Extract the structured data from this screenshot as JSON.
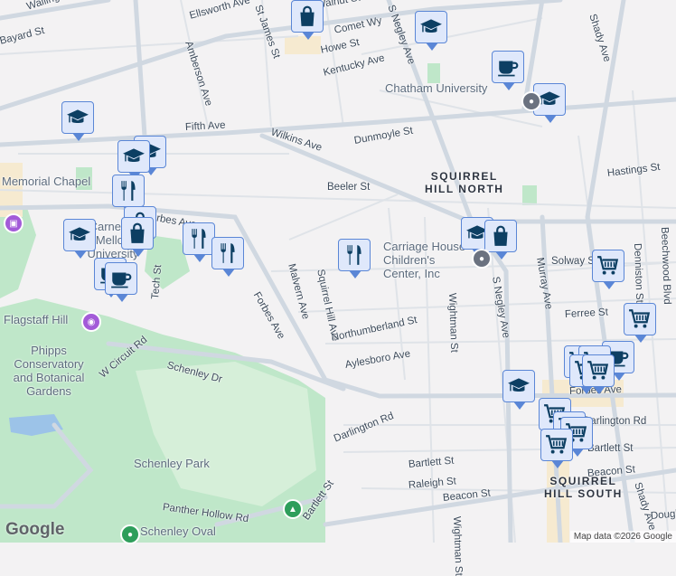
{
  "map": {
    "colors": {
      "background": "#f3f2f3",
      "road": "#d4dbe3",
      "major_road": "#c8d2dc",
      "park": "#bfe7c9",
      "water": "#9cc3e8",
      "marker_bg": "#dfe8fb",
      "marker_border": "#5a86d6",
      "marker_icon": "#0d3f63"
    },
    "street_labels": [
      "Wallingford St",
      "Ellsworth Ave",
      "Bayard St",
      "Amberson Ave",
      "St James St",
      "Walnut St",
      "Comet Wy",
      "Howe St",
      "Kentucky Ave",
      "S Negley Ave",
      "Fifth Ave",
      "Wilkins Ave",
      "Dunmoyle St",
      "Beeler St",
      "Shady Ave",
      "Hastings St",
      "Forbes Ave",
      "Forbes Ave",
      "Malvern Ave",
      "Squirrel Hill Ave",
      "Wightman St",
      "Solway St",
      "Denniston St",
      "Ferree St",
      "Northumberland St",
      "Aylesboro Ave",
      "Murray Ave",
      "Forbes Ave",
      "Darlington Rd",
      "Darlington Rd",
      "Bartlett St",
      "Bartlett St",
      "Raleigh St",
      "Beacon St",
      "Beacon St",
      "Schenley Dr",
      "W Circuit Rd",
      "Panther Hollow Rd",
      "Bartlett St",
      "Tech St",
      "Beechwood Blvd",
      "S Negley Ave",
      "Wightman St",
      "Shady Ave",
      "Douglas St"
    ],
    "poi_labels": [
      "Memorial Chapel",
      "Carnegie Mellon University",
      "Chatham University",
      "Carriage House Children's Center, Inc",
      "Flagstaff Hill",
      "Phipps Conservatory and Botanical Gardens",
      "Schenley Park",
      "Schenley Oval"
    ],
    "neighborhoods": [
      "SQUIRREL\nHILL NORTH",
      "SQUIRREL\nHILL SOUTH"
    ],
    "markers": [
      "shopping",
      "education",
      "coffee",
      "education",
      "education",
      "education",
      "education",
      "restaurant",
      "shopping",
      "shopping",
      "education",
      "restaurant",
      "restaurant",
      "coffee",
      "coffee",
      "restaurant",
      "education",
      "shopping",
      "shopping-cart",
      "shopping-cart",
      "coffee",
      "shopping-cart",
      "shopping-cart",
      "shopping-cart",
      "shopping-cart",
      "education",
      "shopping-cart",
      "shopping-cart",
      "shopping-cart",
      "shopping-cart"
    ],
    "logo": "Google",
    "attribution": "Map data ©2026 Google"
  }
}
